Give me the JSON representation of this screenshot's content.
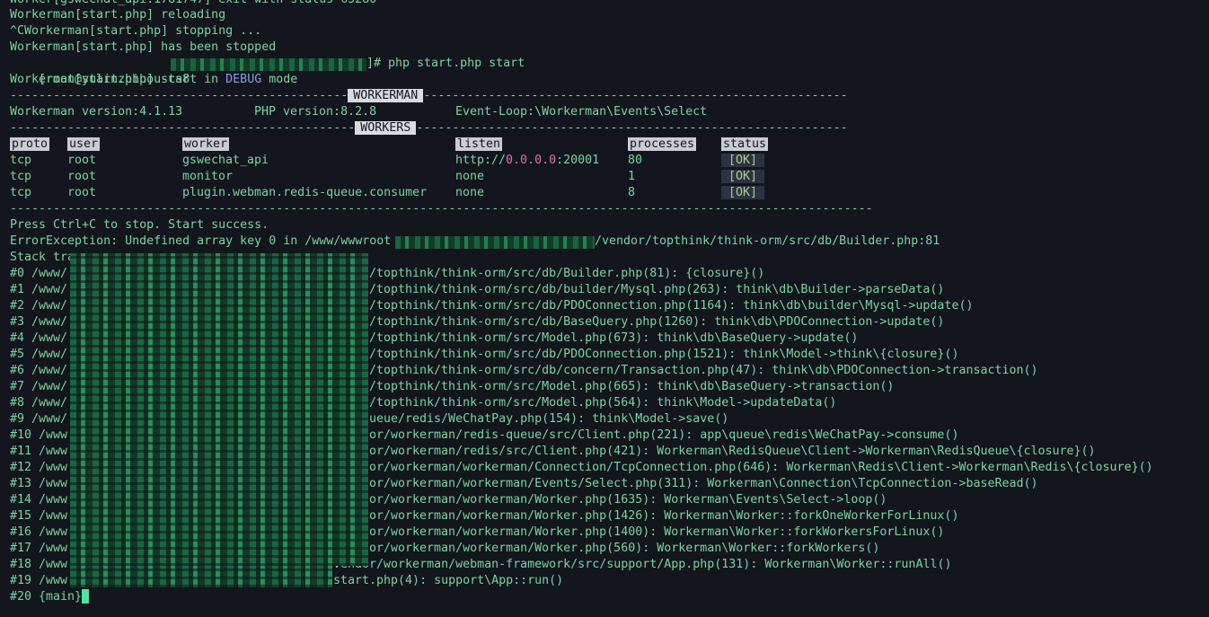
{
  "terminal": {
    "lines": {
      "l0": "Worker[gswechat_api:1781747] exit with status 65280",
      "l1": "Workerman[start.php] reloading",
      "l2": "^CWorkerman[start.php] stopping ...",
      "l3": "Workerman[start.php] has been stopped",
      "prompt_user": "[root@yulinzhihou-cs8",
      "prompt_cmd": "]# php start.php start",
      "start_pre": "Workerman[start.php] start in ",
      "start_debug": "DEBUG",
      "start_post": " mode",
      "sep1_left": "-----------------------------------------------",
      "tag_workerman": "WORKERMAN",
      "sep1_right": "-----------------------------------------------------------",
      "version_workerman": "Workerman version:4.1.13",
      "version_php": "PHP version:8.2.8",
      "version_loop": "Event-Loop:\\Workerman\\Events\\Select",
      "sep2_left": "------------------------------------------------",
      "tag_workers": "WORKERS",
      "sep2_right": "------------------------------------------------------------",
      "sep3": "------------------------------------------------------------------------------------------------------------------------",
      "press": "Press Ctrl+C to stop. Start success.",
      "error_pre": "ErrorException: Undefined array key 0 in /www/wwwroot",
      "error_post": "/vendor/topthink/think-orm/src/db/Builder.php:81",
      "stack": "Stack trace:",
      "last_line": "#20 {main}"
    },
    "workers_table": {
      "headers": {
        "proto": "proto",
        "user": "user",
        "worker": "worker",
        "listen": "listen",
        "processes": "processes",
        "status": "status"
      },
      "rows": [
        {
          "proto": "tcp",
          "user": "root",
          "worker": "gswechat_api",
          "listen_pre": "http://",
          "listen_ip": "0.0.0.0",
          "listen_post": ":20001",
          "processes": "80",
          "status": "[OK]"
        },
        {
          "proto": "tcp",
          "user": "root",
          "worker": "monitor",
          "listen_pre": "none",
          "listen_ip": "",
          "listen_post": "",
          "processes": "1",
          "status": "[OK]"
        },
        {
          "proto": "tcp",
          "user": "root",
          "worker": "plugin.webman.redis-queue.consumer",
          "listen_pre": "none",
          "listen_ip": "",
          "listen_post": "",
          "processes": "8",
          "status": "[OK]"
        }
      ]
    },
    "trace": [
      {
        "num": "#0 /www/",
        "rest": "/topthink/think-orm/src/db/Builder.php(81): {closure}()"
      },
      {
        "num": "#1 /www/",
        "rest": "/topthink/think-orm/src/db/builder/Mysql.php(263): think\\db\\Builder->parseData()"
      },
      {
        "num": "#2 /www/",
        "rest": "/topthink/think-orm/src/db/PDOConnection.php(1164): think\\db\\builder\\Mysql->update()"
      },
      {
        "num": "#3 /www/",
        "rest": "/topthink/think-orm/src/db/BaseQuery.php(1260): think\\db\\PDOConnection->update()"
      },
      {
        "num": "#4 /www/",
        "rest": "/topthink/think-orm/src/Model.php(673): think\\db\\BaseQuery->update()"
      },
      {
        "num": "#5 /www/",
        "rest": "/topthink/think-orm/src/db/PDOConnection.php(1521): think\\Model->think\\{closure}()"
      },
      {
        "num": "#6 /www/",
        "rest": "/topthink/think-orm/src/db/concern/Transaction.php(47): think\\db\\PDOConnection->transaction()"
      },
      {
        "num": "#7 /www/",
        "rest": "/topthink/think-orm/src/Model.php(665): think\\db\\BaseQuery->transaction()"
      },
      {
        "num": "#8 /www/",
        "rest": "/topthink/think-orm/src/Model.php(564): think\\Model->updateData()"
      },
      {
        "num": "#9 /www/",
        "rest": "ueue/redis/WeChatPay.php(154): think\\Model->save()"
      },
      {
        "num": "#10 /www",
        "rest": "or/workerman/redis-queue/src/Client.php(221): app\\queue\\redis\\WeChatPay->consume()"
      },
      {
        "num": "#11 /www",
        "rest": "or/workerman/redis/src/Client.php(421): Workerman\\RedisQueue\\Client->Workerman\\RedisQueue\\{closure}()"
      },
      {
        "num": "#12 /www",
        "rest": "or/workerman/workerman/Connection/TcpConnection.php(646): Workerman\\Redis\\Client->Workerman\\Redis\\{closure}()"
      },
      {
        "num": "#13 /www",
        "rest": "or/workerman/workerman/Events/Select.php(311): Workerman\\Connection\\TcpConnection->baseRead()"
      },
      {
        "num": "#14 /www",
        "rest": "or/workerman/workerman/Worker.php(1635): Workerman\\Events\\Select->loop()"
      },
      {
        "num": "#15 /www",
        "rest": "or/workerman/workerman/Worker.php(1426): Workerman\\Worker::forkOneWorkerForLinux()"
      },
      {
        "num": "#16 /www",
        "rest": "or/workerman/workerman/Worker.php(1400): Workerman\\Worker::forkWorkersForLinux()"
      },
      {
        "num": "#17 /www",
        "rest": "or/workerman/workerman/Worker.php(560): Workerman\\Worker::forkWorkers()"
      },
      {
        "num": "#18 /www",
        "rest": "vendor/workerman/webman-framework/src/support/App.php(131): Workerman\\Worker::runAll()"
      },
      {
        "num": "#19 /www",
        "rest": "start.php(4): support\\App::run()"
      }
    ],
    "colors": {
      "background": "#13161c",
      "text": "#7ed2a3",
      "debug": "#8c9cf0",
      "ip": "#e26fa8",
      "ok": "#a7d48a",
      "cursor": "#4fe3a0"
    }
  }
}
